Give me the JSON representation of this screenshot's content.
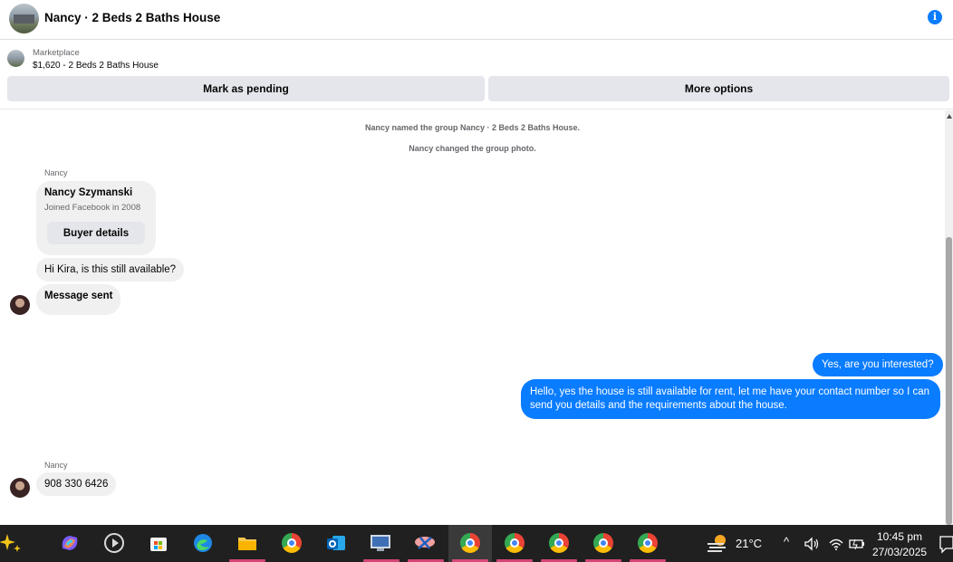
{
  "header": {
    "title": "Nancy · 2 Beds 2 Baths House",
    "info_icon": "info-icon"
  },
  "marketplace": {
    "label": "Marketplace",
    "listing": "$1,620 - 2 Beds 2 Baths House",
    "pending_button": "Mark as pending",
    "more_button": "More options"
  },
  "conversation": {
    "system_messages": [
      "Nancy named the group Nancy · 2 Beds 2 Baths House.",
      "Nancy changed the group photo."
    ],
    "sender_label_1": "Nancy",
    "card": {
      "name": "Nancy Szymanski",
      "joined": "Joined Facebook in 2008",
      "button": "Buyer details"
    },
    "msg_in_1": "Hi Kira, is this still available?",
    "msg_in_2": "Message sent",
    "msg_out_1": "Yes, are you interested?",
    "msg_out_2": "Hello, yes the house is still available for rent, let me have your contact number so I can send you details and the requirements about the house.",
    "sender_label_2": "Nancy",
    "msg_in_3": "908 330 6426"
  },
  "taskbar": {
    "weather": "21°C",
    "time": "10:45 pm",
    "date": "27/03/2025",
    "accent_color": "#0a7cff"
  }
}
